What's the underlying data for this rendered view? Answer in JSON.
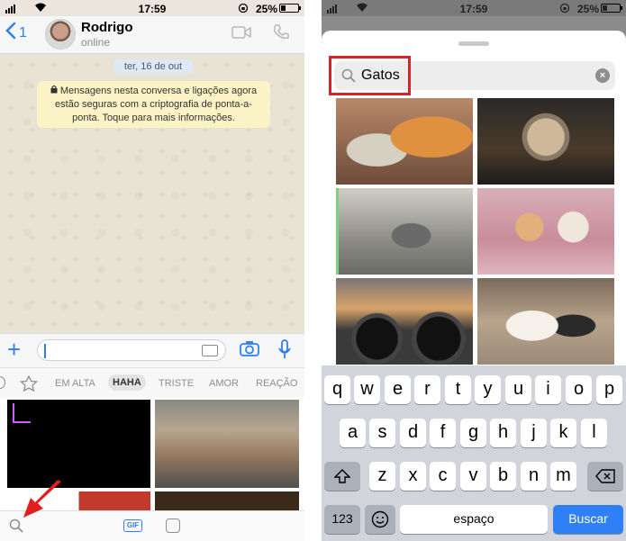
{
  "left": {
    "status": {
      "time": "17:59",
      "battery": "25%"
    },
    "header": {
      "back_count": "1",
      "name": "Rodrigo",
      "status": "online"
    },
    "chat": {
      "date": "ter, 16 de out",
      "encryption_notice": "Mensagens nesta conversa e ligações agora estão seguras com a criptografia de ponta-a-ponta. Toque para mais informações."
    },
    "tabs": [
      "EM ALTA",
      "HAHA",
      "TRISTE",
      "AMOR",
      "REAÇÃO"
    ],
    "active_tab": "HAHA",
    "bottom_bar": {
      "gif_label": "GIF"
    },
    "icons": [
      "back-chevron-icon",
      "video-call-icon",
      "phone-call-icon",
      "plus-icon",
      "keyboard-icon",
      "camera-icon",
      "microphone-icon",
      "star-icon",
      "search-icon",
      "sticker-icon",
      "red-arrow-icon"
    ]
  },
  "right": {
    "status": {
      "time": "17:59",
      "battery": "25%"
    },
    "search": {
      "query": "Gatos"
    },
    "highlight_color": "#d7232a",
    "keyboard": {
      "row1": [
        "q",
        "w",
        "e",
        "r",
        "t",
        "y",
        "u",
        "i",
        "o",
        "p"
      ],
      "row2": [
        "a",
        "s",
        "d",
        "f",
        "g",
        "h",
        "j",
        "k",
        "l"
      ],
      "row3": [
        "z",
        "x",
        "c",
        "v",
        "b",
        "n",
        "m"
      ],
      "numbers_key": "123",
      "space_key": "espaço",
      "go_key": "Buscar"
    }
  },
  "colors": {
    "accent": "#2f7ff6",
    "notice_bg": "#fbf3c5",
    "chat_bg": "#e9e3d6"
  }
}
